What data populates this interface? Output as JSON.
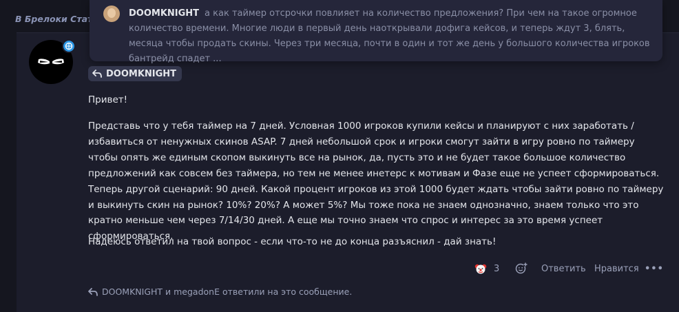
{
  "breadcrumb": "В Брелоки Стат",
  "popup": {
    "author": "DOOMKNIGHT",
    "text": "а как таймер отсрочки повлияет на количество предложения? При чем на такое огромное количество времени. Многие люди в первый день наоткрывали дофига кейсов, и теперь ждут 3, блять, месяца чтобы продать скины. Через три месяца, почти в один и тот же день у большого количества игроков бантрейд спадет ..."
  },
  "quote_tag": {
    "author": "DOOMKNIGHT"
  },
  "post": {
    "greeting": "Привет!",
    "main": "Представь что у тебя таймер на 7 дней. Условная 1000 игроков купили кейсы и планируют с них заработать / избавиться от ненужных скинов ASAP. 7 дней небольшой срок и игроки смогут зайти в игру ровно по таймеру чтобы опять же единым скопом выкинуть все на рынок, да, пусть это и не будет такое большое количество предложений как совсем без таймера, но тем не менее инетерс к мотивам и Фазе еще не успеет сформироваться. Теперь другой сценарий: 90 дней. Какой процент игроков из этой 1000 будет ждать чтобы зайти ровно по таймеру и выкинуть скин на рынок? 10%? 20%? А может 5%? Мы тоже пока не знаем однозначно, знаем только что это кратно меньше чем через 7/14/30 дней. А еще мы точно знаем что спрос и интерес за это время успеет сформироваться.",
    "closing": "Надеюсь ответил на твой вопрос - если что-то не до конца разъяснил - дай знать!"
  },
  "actions": {
    "reaction_icon": "clown-face-icon",
    "reaction_count": "3",
    "reply_label": "Ответить",
    "like_label": "Нравится",
    "more_label": "•••"
  },
  "replied_by": "DOOMKNIGHT и megadonE ответили на это сообщение.",
  "colors": {
    "background": "#15161f",
    "post_bg": "#1c1d2b",
    "popup_bg": "#25263a",
    "tag_bg": "#34374d",
    "muted_text": "#9aa0b8",
    "verified_badge": "#2d97e6"
  }
}
